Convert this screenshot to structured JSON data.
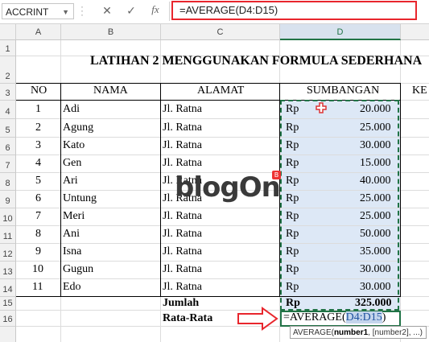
{
  "formula_bar": {
    "name_box": "ACCRINT",
    "name_box_arrow": "▼",
    "cancel_glyph": "✕",
    "enter_glyph": "✓",
    "fx_glyph": "fx",
    "formula": "=AVERAGE(D4:D15)"
  },
  "columns": [
    "A",
    "B",
    "C",
    "D"
  ],
  "rows": [
    "1",
    "2",
    "3",
    "4",
    "5",
    "6",
    "7",
    "8",
    "9",
    "10",
    "11",
    "12",
    "13",
    "14",
    "15",
    "16"
  ],
  "sheet": {
    "title": "LATIHAN 2 MENGGUNAKAN FORMULA SEDERHANA",
    "headers": {
      "no": "NO",
      "nama": "NAMA",
      "alamat": "ALAMAT",
      "sumbangan": "SUMBANGAN",
      "ket": "KE"
    },
    "rows": [
      {
        "no": "1",
        "nama": "Adi",
        "alamat": "Jl. Ratna",
        "rp": "Rp",
        "amount": "20.000"
      },
      {
        "no": "2",
        "nama": "Agung",
        "alamat": "Jl. Ratna",
        "rp": "Rp",
        "amount": "25.000"
      },
      {
        "no": "3",
        "nama": "Kato",
        "alamat": "Jl. Ratna",
        "rp": "Rp",
        "amount": "30.000"
      },
      {
        "no": "4",
        "nama": "Gen",
        "alamat": "Jl. Ratna",
        "rp": "Rp",
        "amount": "15.000"
      },
      {
        "no": "5",
        "nama": "Ari",
        "alamat": "Jl. Ratna",
        "rp": "Rp",
        "amount": "40.000"
      },
      {
        "no": "6",
        "nama": "Untung",
        "alamat": "Jl. Ratna",
        "rp": "Rp",
        "amount": "25.000"
      },
      {
        "no": "7",
        "nama": "Meri",
        "alamat": "Jl. Ratna",
        "rp": "Rp",
        "amount": "25.000"
      },
      {
        "no": "8",
        "nama": "Ani",
        "alamat": "Jl. Ratna",
        "rp": "Rp",
        "amount": "50.000"
      },
      {
        "no": "9",
        "nama": "Isna",
        "alamat": "Jl. Ratna",
        "rp": "Rp",
        "amount": "35.000"
      },
      {
        "no": "10",
        "nama": "Gugun",
        "alamat": "Jl. Ratna",
        "rp": "Rp",
        "amount": "30.000"
      },
      {
        "no": "11",
        "nama": "Edo",
        "alamat": "Jl. Ratna",
        "rp": "Rp",
        "amount": "30.000"
      }
    ],
    "jumlah_label": "Jumlah",
    "jumlah_rp": "Rp",
    "jumlah_value": "325.000",
    "rata_label": "Rata-Rata",
    "editing_prefix": "=AVERAGE(",
    "editing_ref": "D4:D15",
    "editing_suffix": ")"
  },
  "tooltip": {
    "fn": "AVERAGE(",
    "arg1": "number1",
    "rest": ", [number2], ...)"
  },
  "watermark": {
    "text_a": "blog",
    "text_o": "O",
    "text_b": "n",
    "badge": "B"
  },
  "colors": {
    "accent": "#217346",
    "selection": "#dde8f6",
    "highlight_red": "#e8262d"
  }
}
